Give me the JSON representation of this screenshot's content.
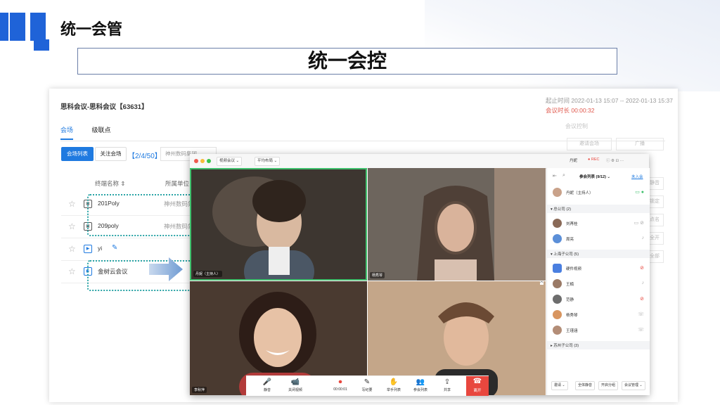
{
  "slide": {
    "title": "统一会管",
    "banner": "统一会控"
  },
  "conference": {
    "title": "思科会议-思科会议【63631】",
    "start_time_label": "起止时间 2022-01-13 15:07 -- 2022-01-13 15:37",
    "duration_label": "会议时长 00:00:32",
    "tabs": [
      "会场",
      "级联点"
    ],
    "site_list_btn": "会场列表",
    "follow_btn": "关注会场",
    "count": "【2/4/50】",
    "org_filter": "神州数码集团",
    "col_name": "终端名称 ⇕",
    "col_org": "所属单位",
    "rows": [
      {
        "name": "201Poly",
        "org": "神州数码集"
      },
      {
        "name": "209poly",
        "org": "神州数码集"
      },
      {
        "name": "yi",
        "org": ""
      },
      {
        "name": "金树云会议",
        "org": ""
      }
    ],
    "right_title": "会议控制",
    "right_buttons": [
      "邀请会场",
      "广播",
      "静音",
      "锁定",
      "点名",
      "全开",
      "全部",
      "会后"
    ]
  },
  "video": {
    "chips": [
      "视频会议 ⌄",
      "平均布局 ⌄"
    ],
    "top_right": [
      "丹妮",
      "● REC"
    ],
    "tiles": [
      {
        "name": "丹妮（主持人）",
        "colors": [
          "#3d3630",
          "#8a7a6c",
          "#cfc6bd"
        ]
      },
      {
        "name": "杨秀琴",
        "colors": [
          "#5b5751",
          "#9c8878",
          "#7f6c60"
        ]
      },
      {
        "name": "李秋萍",
        "colors": [
          "#4c3a30",
          "#b85a4a",
          "#e9d8c6"
        ]
      },
      {
        "name": "",
        "colors": [
          "#c4a689",
          "#b99374",
          "#5a4a3e"
        ]
      }
    ],
    "controls": [
      {
        "icon": "🎤",
        "label": "静音"
      },
      {
        "icon": "📹",
        "label": "关闭视频"
      },
      {
        "icon": "⏺",
        "label": "00:00:01"
      },
      {
        "icon": "✎",
        "label": "写纪要"
      },
      {
        "icon": "✋",
        "label": "举手列表"
      },
      {
        "icon": "👥",
        "label": "参会列表"
      },
      {
        "icon": "⇪",
        "label": "共享"
      }
    ],
    "leave_label": "离开"
  },
  "participants": {
    "title": "参会列表 (9/12) ⌄",
    "invite": "未入会",
    "host": {
      "name": "丹妮（主持人）"
    },
    "groups": [
      {
        "label": "▾ 总公司 (2)",
        "members": [
          "刘苒桂",
          "周亮"
        ]
      },
      {
        "label": "▾ 上海子公司 (5)",
        "members": [
          "硬件视频",
          "王楠",
          "范静",
          "杨秀琴",
          "王瑾涵"
        ]
      },
      {
        "label": "▸ 苏州子公司 (3)",
        "members": []
      }
    ],
    "buttons": [
      "邀请 ⌄",
      "全体静音",
      "开启分组",
      "会议管理 ⌄"
    ]
  },
  "colors": {
    "accent": "#1f7ae0",
    "brand": "#1f63d8",
    "dash": "#2aa4a6",
    "leave": "#e8473e"
  }
}
